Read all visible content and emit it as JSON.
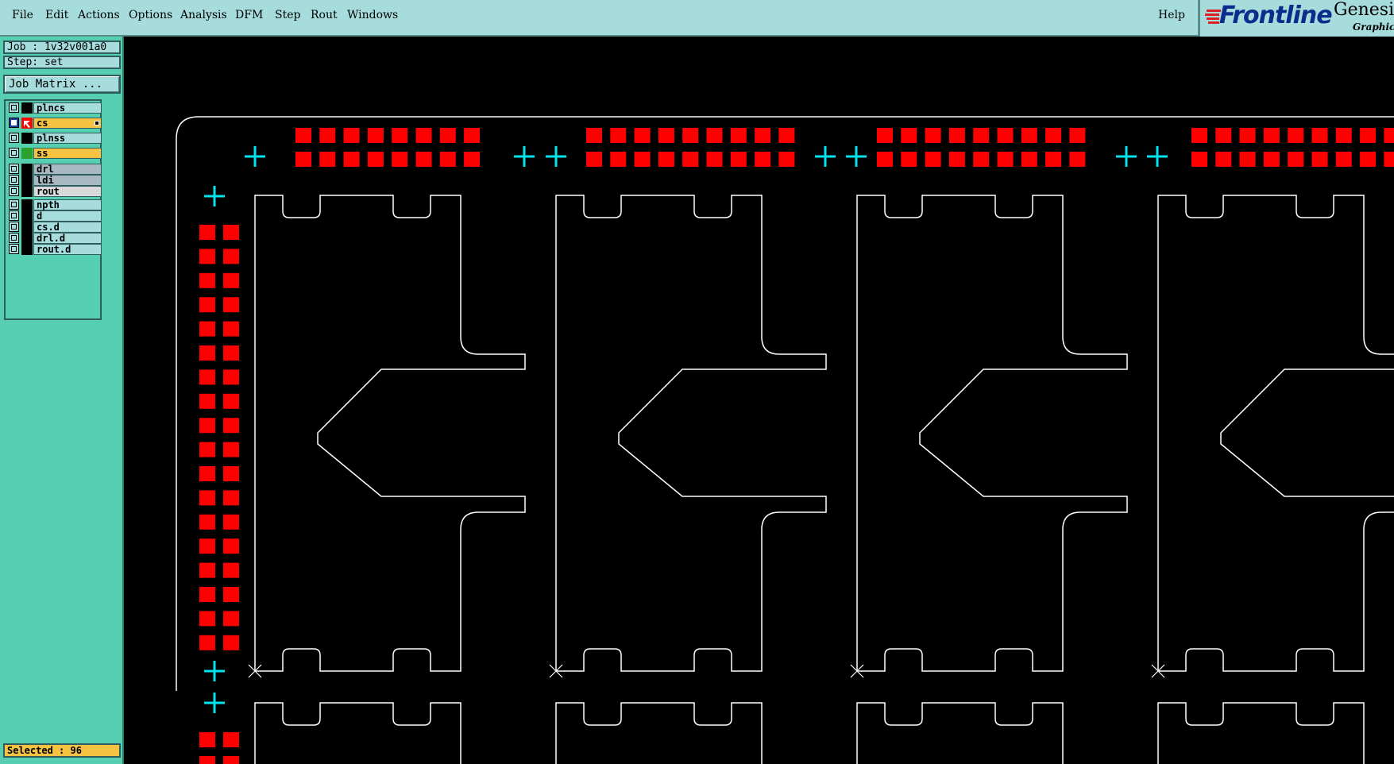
{
  "menubar": {
    "items": [
      "File",
      "Edit",
      "Actions",
      "Options",
      "Analysis",
      "DFM",
      "Step",
      "Rout",
      "Windows"
    ],
    "help": "Help"
  },
  "logo": {
    "brand": "Frontline",
    "product": "Genesis",
    "tagline": "Graphic E"
  },
  "job": {
    "job_label": "Job : 1v32v001a0",
    "step_label": "Step: set",
    "matrix_button": "Job Matrix ..."
  },
  "layers": [
    {
      "name": "plncs",
      "style": "plain",
      "active": false
    },
    {
      "name": "cs",
      "style": "orange",
      "active": true,
      "color": "#ff0000"
    },
    {
      "name": "plnss",
      "style": "plain",
      "active": false
    },
    {
      "name": "ss",
      "style": "orange",
      "active": false,
      "color": "#2ca02c"
    },
    {
      "name": "drl",
      "style": "grey",
      "active": false
    },
    {
      "name": "ldi",
      "style": "grey",
      "active": false
    },
    {
      "name": "rout",
      "style": "lightgrey",
      "active": false
    },
    {
      "name": "npth",
      "style": "plain",
      "active": false
    },
    {
      "name": "d",
      "style": "plain",
      "active": false
    },
    {
      "name": "cs.d",
      "style": "plain",
      "active": false
    },
    {
      "name": "drl.d",
      "style": "plain",
      "active": false
    },
    {
      "name": "rout.d",
      "style": "plain",
      "active": false
    }
  ],
  "status": {
    "selected": "Selected : 96"
  },
  "colors": {
    "pad": "#ff0000",
    "fiducial": "#00e5ee",
    "outline": "#ffffff",
    "background": "#000000",
    "menubar": "#a6dcdc",
    "panel": "#56cfb0"
  }
}
